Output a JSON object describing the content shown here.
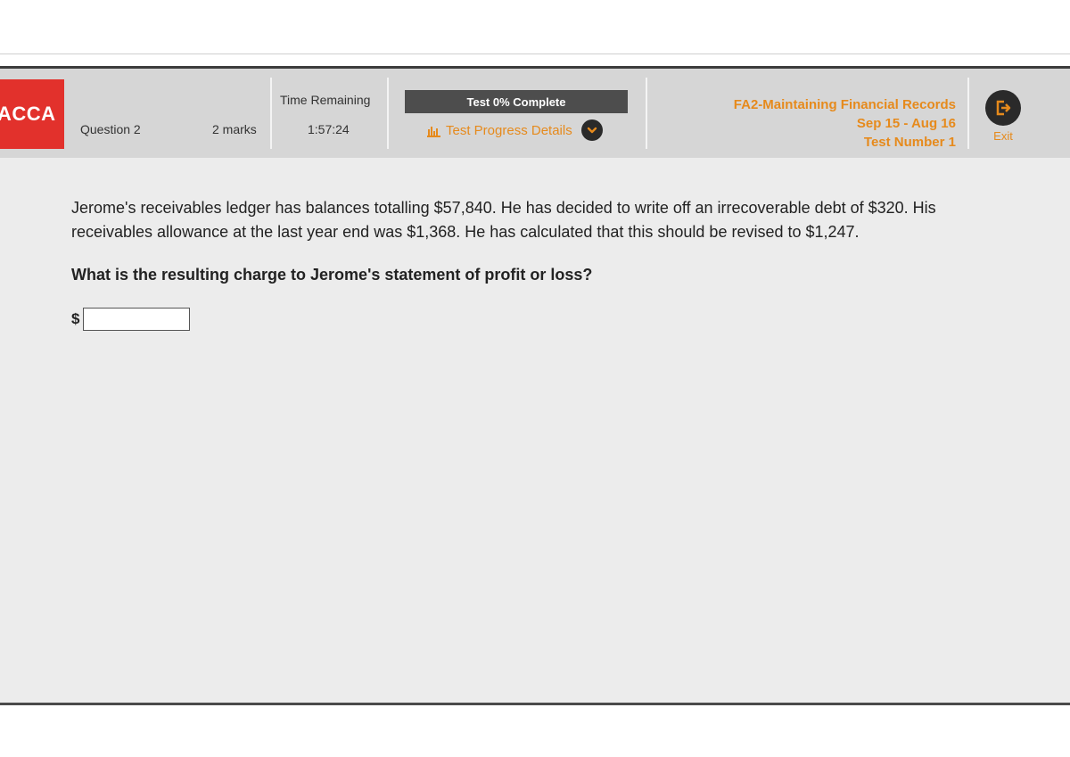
{
  "header": {
    "logo": "ACCA",
    "question_number": "Question 2",
    "marks": "2 marks",
    "time_label": "Time Remaining",
    "time_value": "1:57:24",
    "progress": {
      "label": "Test 0% Complete",
      "percent": 0,
      "details_link": "Test Progress Details"
    },
    "exam": {
      "title": "FA2-Maintaining Financial Records",
      "session": "Sep 15 - Aug 16",
      "test_number": "Test Number 1"
    },
    "exit_label": "Exit"
  },
  "question": {
    "text": "Jerome's receivables ledger has balances totalling $57,840. He has decided to write off an irrecoverable debt of $320. His receivables allowance at the last year end was $1,368. He has calculated that this should be revised to $1,247.",
    "prompt": "What is the resulting charge to Jerome's statement of profit or loss?",
    "currency_symbol": "$",
    "answer_value": ""
  },
  "colors": {
    "accent": "#e68a1c",
    "logo_bg": "#e2312c",
    "header_bg": "#d6d6d6",
    "progress_bg": "#4d4d4d",
    "content_bg": "#ececec"
  },
  "icons": [
    "bar-chart-icon",
    "chevron-down-icon",
    "exit-icon"
  ]
}
